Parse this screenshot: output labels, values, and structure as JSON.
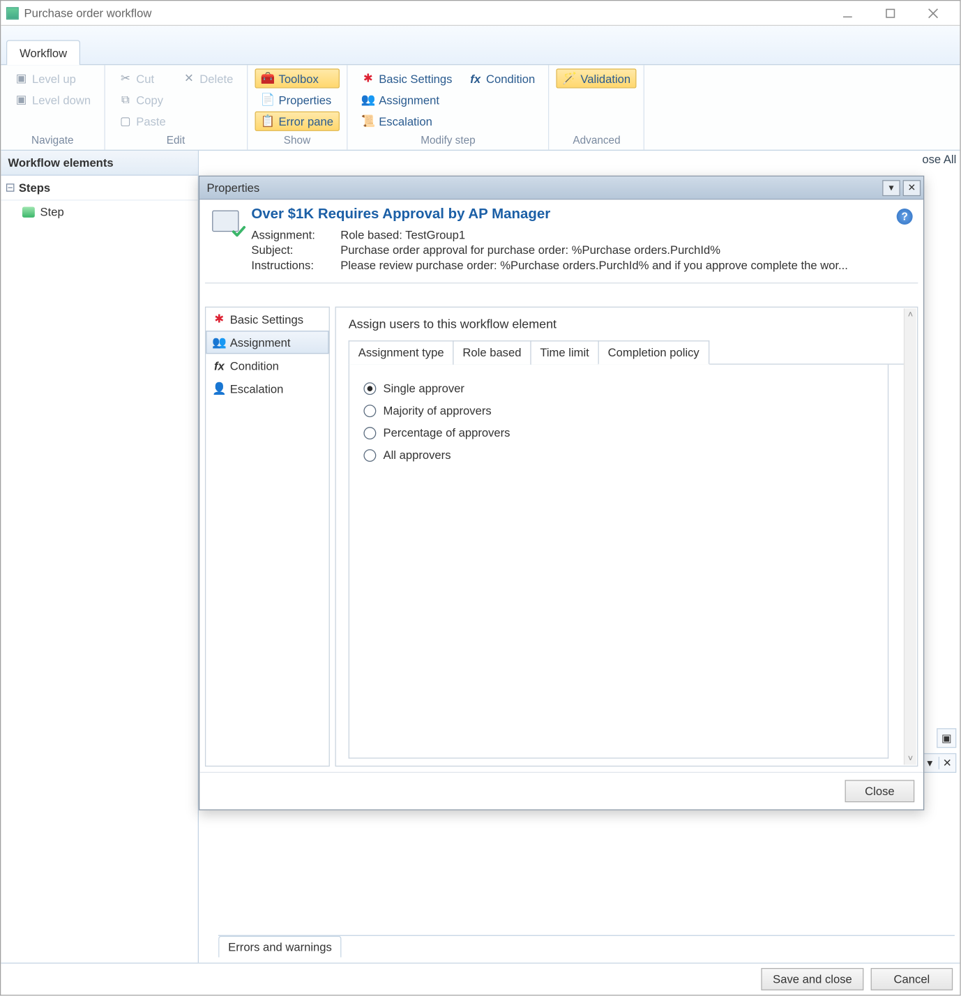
{
  "window": {
    "title": "Purchase order workflow"
  },
  "ribbon": {
    "tabs": [
      "Workflow"
    ],
    "groups": {
      "navigate": {
        "title": "Navigate",
        "level_up": "Level up",
        "level_down": "Level down"
      },
      "edit": {
        "title": "Edit",
        "cut": "Cut",
        "copy": "Copy",
        "paste": "Paste",
        "delete": "Delete"
      },
      "show": {
        "title": "Show",
        "toolbox": "Toolbox",
        "properties": "Properties",
        "error_pane": "Error pane"
      },
      "modify": {
        "title": "Modify step",
        "basic": "Basic Settings",
        "assignment": "Assignment",
        "condition": "Condition",
        "escalation": "Escalation"
      },
      "advanced": {
        "title": "Advanced",
        "validation": "Validation"
      }
    }
  },
  "side": {
    "panel_title": "Workflow elements",
    "steps_header": "Steps",
    "step_item": "Step"
  },
  "background": {
    "ose_all": "ose All",
    "errors_tab": "Errors and warnings"
  },
  "footer": {
    "save": "Save and close",
    "cancel": "Cancel"
  },
  "dialog": {
    "title": "Properties",
    "heading": "Over $1K Requires Approval by AP Manager",
    "labels": {
      "assignment": "Assignment:",
      "subject": "Subject:",
      "instructions": "Instructions:"
    },
    "values": {
      "assignment": "Role based: TestGroup1",
      "subject": "Purchase order approval for purchase order: %Purchase orders.PurchId%",
      "instructions": "Please review purchase order: %Purchase orders.PurchId% and if you approve complete the wor..."
    },
    "nav": {
      "basic": "Basic Settings",
      "assignment": "Assignment",
      "condition": "Condition",
      "escalation": "Escalation"
    },
    "content_title": "Assign users to this workflow element",
    "tabs": {
      "assignment_type": "Assignment type",
      "role_based": "Role based",
      "time_limit": "Time limit",
      "completion_policy": "Completion policy"
    },
    "options": {
      "single": "Single approver",
      "majority": "Majority of approvers",
      "percentage": "Percentage of approvers",
      "all": "All approvers"
    },
    "close": "Close"
  }
}
